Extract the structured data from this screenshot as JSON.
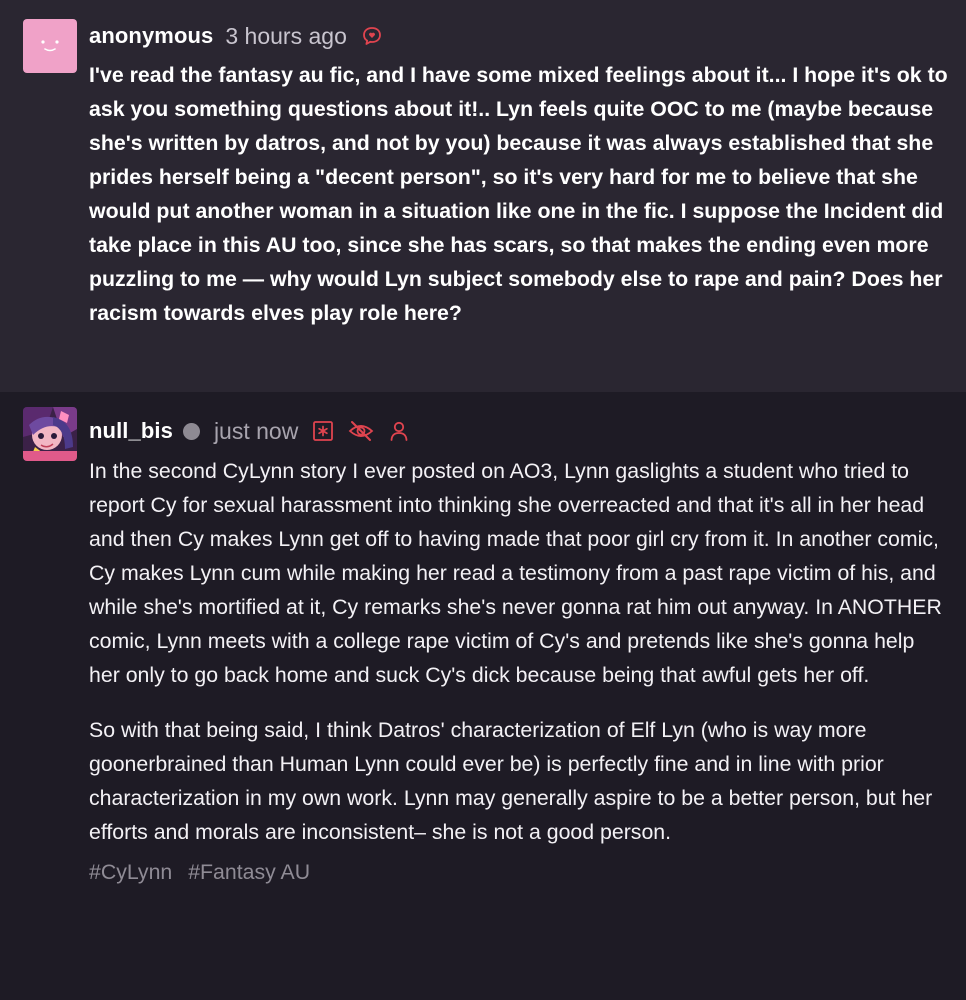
{
  "ask": {
    "username": "anonymous",
    "time": "3 hours ago",
    "body": "I've read the fantasy au fic, and I have some mixed feelings about it... I hope it's ok to ask you something questions about it!.. Lyn feels quite OOC to me (maybe because she's written by datros, and not by you) because it was always established that she prides herself being a \"decent person\", so it's very hard for me to believe that she would put another woman in a situation like one in the fic. I suppose the Incident did take place in this AU too, since she has scars, so that makes the ending even more puzzling to me — why would Lyn subject somebody else to rape and pain? Does her racism towards elves play role here?"
  },
  "reply": {
    "username": "null_bis",
    "time": "just now",
    "paragraphs": [
      "In the second CyLynn story I ever posted on AO3, Lynn gaslights a student who tried to report Cy for sexual harassment into thinking she overreacted and that it's all in her head and then Cy makes Lynn get off to having made that poor girl cry from it. In another comic, Cy makes Lynn cum while making her read a testimony from a past rape victim of his, and while she's mortified at it, Cy remarks she's never gonna rat him out anyway. In ANOTHER comic, Lynn meets with a college rape victim of Cy's and pretends like she's gonna help her only to go back home and suck Cy's dick because being that awful gets her off.",
      "So with that being said, I think Datros' characterization of Elf Lyn (who is way more goonerbrained than Human Lynn could ever be) is perfectly fine and in line with prior characterization in my own work. Lynn may generally aspire to be a better person, but her efforts and morals are inconsistent– she is not a good person."
    ],
    "tags": [
      "#CyLynn",
      "#Fantasy AU"
    ]
  },
  "colors": {
    "ask_bg": "#2a2631",
    "reply_bg": "#1e1b25",
    "accent_red": "#e0444f",
    "anon_avatar": "#f0a2c8"
  },
  "icons": {
    "ask_header": "anonymous-ask-icon",
    "reply_header": [
      "sensitive-content-icon",
      "hidden-eye-icon",
      "person-icon"
    ]
  }
}
